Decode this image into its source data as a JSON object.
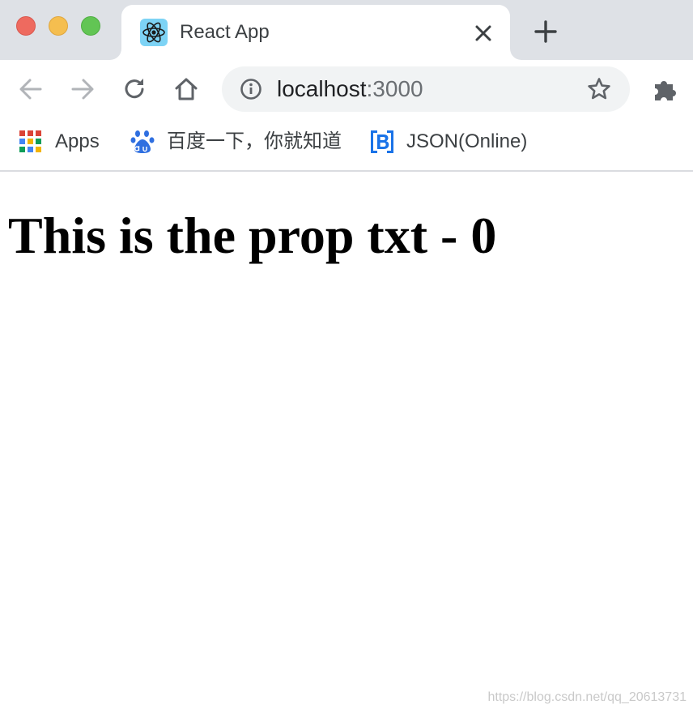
{
  "window": {
    "traffic_lights": {
      "close": "#ee6a5f",
      "minimize": "#f5be4f",
      "maximize": "#62c554"
    }
  },
  "tab": {
    "title": "React App",
    "favicon": "react-logo-icon",
    "favicon_color": "#7dd3f5"
  },
  "toolbar": {
    "back_icon": "arrow-left-icon",
    "forward_icon": "arrow-right-icon",
    "reload_icon": "reload-icon",
    "home_icon": "home-icon",
    "extensions_icon": "puzzle-icon"
  },
  "omnibox": {
    "host": "localhost",
    "port": ":3000",
    "info_icon": "info-icon",
    "bookmark_icon": "star-icon"
  },
  "bookmarks": [
    {
      "label": "Apps",
      "icon": "apps-grid-icon"
    },
    {
      "label": "百度一下，你就知道",
      "icon": "baidu-paw-icon"
    },
    {
      "label": "JSON(Online)",
      "icon": "bejson-logo-icon"
    }
  ],
  "page": {
    "heading": "This is the prop txt - 0"
  },
  "watermark": "https://blog.csdn.net/qq_20613731"
}
